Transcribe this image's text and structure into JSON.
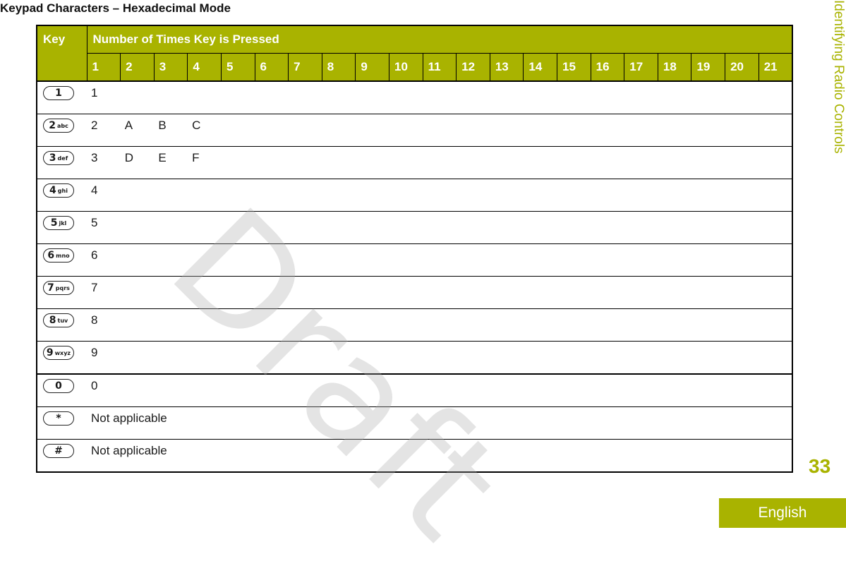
{
  "document": {
    "title": "Keypad Characters – Hexadecimal Mode",
    "side_section": "Identifying Radio Controls",
    "page_number": "33",
    "language_tab": "English",
    "watermark": "Draft"
  },
  "table": {
    "header_key": "Key",
    "header_presses": "Number of Times Key is Pressed",
    "press_columns": [
      "1",
      "2",
      "3",
      "4",
      "5",
      "6",
      "7",
      "8",
      "9",
      "10",
      "11",
      "12",
      "13",
      "14",
      "15",
      "16",
      "17",
      "18",
      "19",
      "20",
      "21"
    ],
    "rows": [
      {
        "key_icon": "key-1-icon",
        "key_digit": "1",
        "key_letters": "",
        "chars": [
          "1"
        ],
        "note": ""
      },
      {
        "key_icon": "key-2-abc-icon",
        "key_digit": "2",
        "key_letters": "abc",
        "chars": [
          "2",
          "A",
          "B",
          "C"
        ],
        "note": ""
      },
      {
        "key_icon": "key-3-def-icon",
        "key_digit": "3",
        "key_letters": "def",
        "chars": [
          "3",
          "D",
          "E",
          "F"
        ],
        "note": ""
      },
      {
        "key_icon": "key-4-ghi-icon",
        "key_digit": "4",
        "key_letters": "ghi",
        "chars": [
          "4"
        ],
        "note": ""
      },
      {
        "key_icon": "key-5-jkl-icon",
        "key_digit": "5",
        "key_letters": "jkl",
        "chars": [
          "5"
        ],
        "note": ""
      },
      {
        "key_icon": "key-6-mno-icon",
        "key_digit": "6",
        "key_letters": "mno",
        "chars": [
          "6"
        ],
        "note": ""
      },
      {
        "key_icon": "key-7-pqrs-icon",
        "key_digit": "7",
        "key_letters": "pqrs",
        "chars": [
          "7"
        ],
        "note": ""
      },
      {
        "key_icon": "key-8-tuv-icon",
        "key_digit": "8",
        "key_letters": "tuv",
        "chars": [
          "8"
        ],
        "note": ""
      },
      {
        "key_icon": "key-9-wxyz-icon",
        "key_digit": "9",
        "key_letters": "wxyz",
        "chars": [
          "9"
        ],
        "note": ""
      },
      {
        "key_icon": "key-0-icon",
        "key_digit": "0",
        "key_letters": "",
        "chars": [
          "0"
        ],
        "note": ""
      },
      {
        "key_icon": "key-star-icon",
        "key_digit": "*",
        "key_letters": "",
        "chars": [],
        "note": "Not applicable"
      },
      {
        "key_icon": "key-hash-icon",
        "key_digit": "#",
        "key_letters": "",
        "chars": [],
        "note": "Not applicable"
      }
    ]
  },
  "colors": {
    "accent": "#a9b300",
    "header_text": "#ffffff",
    "watermark": "#d9d9d9"
  }
}
